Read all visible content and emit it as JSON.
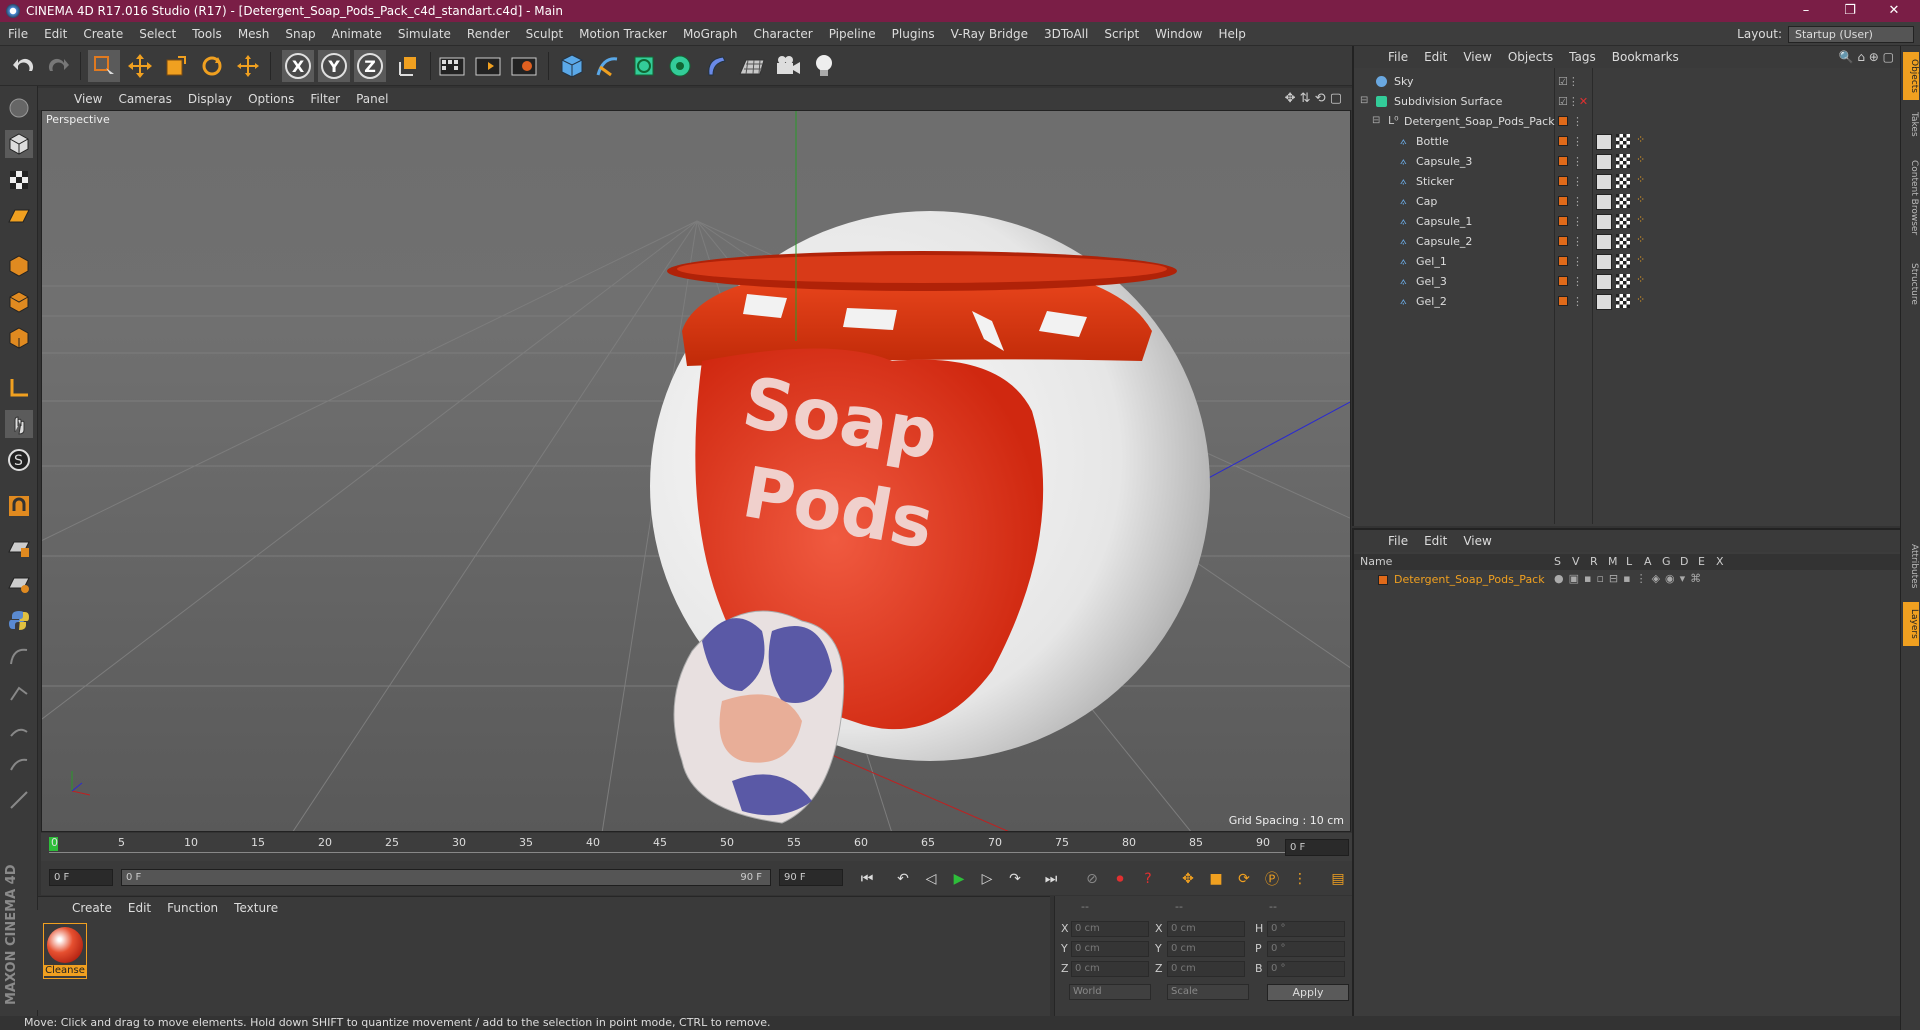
{
  "window": {
    "title": "CINEMA 4D R17.016 Studio (R17) - [Detergent_Soap_Pods_Pack_c4d_standart.c4d] - Main",
    "controls": [
      "–",
      "❐",
      "✕"
    ]
  },
  "menubar": {
    "items": [
      "File",
      "Edit",
      "Create",
      "Select",
      "Tools",
      "Mesh",
      "Snap",
      "Animate",
      "Simulate",
      "Render",
      "Sculpt",
      "Motion Tracker",
      "MoGraph",
      "Character",
      "Pipeline",
      "Plugins",
      "V-Ray Bridge",
      "3DToAll",
      "Script",
      "Window",
      "Help"
    ],
    "layout_label": "Layout:",
    "layout_value": "Startup (User)"
  },
  "viewport": {
    "menu": [
      "View",
      "Cameras",
      "Display",
      "Options",
      "Filter",
      "Panel"
    ],
    "label": "Perspective",
    "grid_spacing": "Grid Spacing : 10 cm",
    "model_text_line1": "Soap",
    "model_text_line2": "Pods"
  },
  "timeline": {
    "ticks": [
      "0",
      "5",
      "10",
      "15",
      "20",
      "25",
      "30",
      "35",
      "40",
      "45",
      "50",
      "55",
      "60",
      "65",
      "70",
      "75",
      "80",
      "85",
      "90"
    ],
    "current_frame": "0 F",
    "start_field": "0 F",
    "range_start": "0 F",
    "range_end": "90 F",
    "end_field": "90 F"
  },
  "material_manager": {
    "menu": [
      "Create",
      "Edit",
      "Function",
      "Texture"
    ],
    "materials": [
      {
        "name": "Cleanse"
      }
    ]
  },
  "coordinates": {
    "header": [
      "--",
      "--",
      "--"
    ],
    "rows": [
      {
        "a": "X",
        "av": "0 cm",
        "b": "X",
        "bv": "0 cm",
        "c": "H",
        "cv": "0 °"
      },
      {
        "a": "Y",
        "av": "0 cm",
        "b": "Y",
        "bv": "0 cm",
        "c": "P",
        "cv": "0 °"
      },
      {
        "a": "Z",
        "av": "0 cm",
        "b": "Z",
        "bv": "0 cm",
        "c": "B",
        "cv": "0 °"
      }
    ],
    "world": "World",
    "scale": "Scale",
    "apply": "Apply"
  },
  "object_manager": {
    "menu": [
      "File",
      "Edit",
      "View",
      "Objects",
      "Tags",
      "Bookmarks"
    ],
    "objects": [
      {
        "name": "Sky",
        "level": 0
      },
      {
        "name": "Subdivision Surface",
        "level": 0
      },
      {
        "name": "Detergent_Soap_Pods_Pack",
        "level": 1
      },
      {
        "name": "Bottle",
        "level": 2
      },
      {
        "name": "Capsule_3",
        "level": 2
      },
      {
        "name": "Sticker",
        "level": 2
      },
      {
        "name": "Cap",
        "level": 2
      },
      {
        "name": "Capsule_1",
        "level": 2
      },
      {
        "name": "Capsule_2",
        "level": 2
      },
      {
        "name": "Gel_1",
        "level": 2
      },
      {
        "name": "Gel_3",
        "level": 2
      },
      {
        "name": "Gel_2",
        "level": 2
      }
    ]
  },
  "layer_manager": {
    "menu": [
      "File",
      "Edit",
      "View"
    ],
    "columns": [
      "Name",
      "S",
      "V",
      "R",
      "M",
      "L",
      "A",
      "G",
      "D",
      "E",
      "X"
    ],
    "layers": [
      {
        "name": "Detergent_Soap_Pods_Pack",
        "color": "#e06a1a"
      }
    ]
  },
  "right_tabs": [
    "Objects",
    "Takes",
    "Content Browser",
    "Structure",
    "Attributes",
    "Layers"
  ],
  "status": "Move: Click and drag to move elements. Hold down SHIFT to quantize movement / add to the selection in point mode, CTRL to remove.",
  "branding": "MAXON CINEMA 4D"
}
